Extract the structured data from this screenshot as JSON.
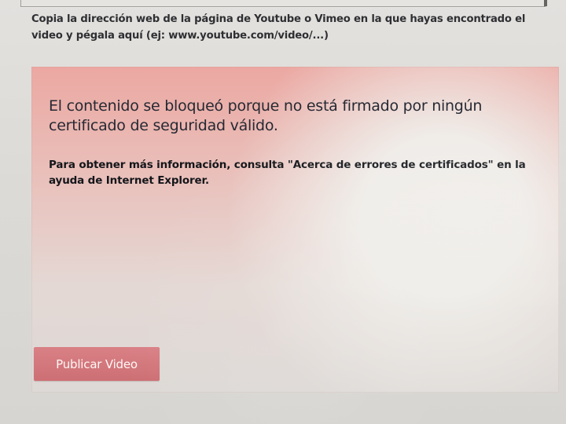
{
  "form": {
    "instruction": "Copia la dirección web de la página de Youtube o Vimeo en la que hayas encontrado el video y pégala aquí (ej: www.youtube.com/video/...)"
  },
  "error_panel": {
    "title": "El contenido se bloqueó porque no está firmado por ningún certificado de seguridad válido.",
    "help": "Para obtener más información, consulta \"Acerca de errores de certificados\" en la ayuda de Internet Explorer."
  },
  "actions": {
    "publish_label": "Publicar Video"
  },
  "colors": {
    "error_panel": "#eca8a2",
    "publish_button": "#d98186",
    "background": "#d8d6d3"
  }
}
